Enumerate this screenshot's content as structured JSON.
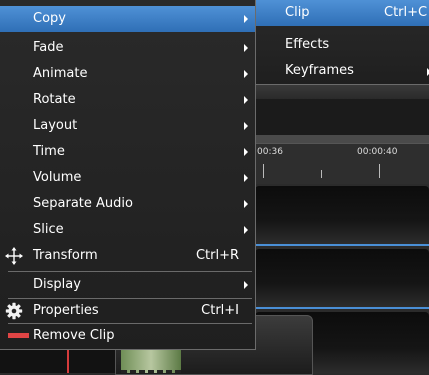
{
  "menu": {
    "items": [
      {
        "label": "Copy",
        "shortcut": "",
        "submenu": true
      },
      {
        "label": "Fade",
        "shortcut": "",
        "submenu": true
      },
      {
        "label": "Animate",
        "shortcut": "",
        "submenu": true
      },
      {
        "label": "Rotate",
        "shortcut": "",
        "submenu": true
      },
      {
        "label": "Layout",
        "shortcut": "",
        "submenu": true
      },
      {
        "label": "Time",
        "shortcut": "",
        "submenu": true
      },
      {
        "label": "Volume",
        "shortcut": "",
        "submenu": true
      },
      {
        "label": "Separate Audio",
        "shortcut": "",
        "submenu": true
      },
      {
        "label": "Slice",
        "shortcut": "",
        "submenu": true
      },
      {
        "label": "Transform",
        "shortcut": "Ctrl+R",
        "submenu": false
      },
      {
        "label": "Display",
        "shortcut": "",
        "submenu": true
      },
      {
        "label": "Properties",
        "shortcut": "Ctrl+I",
        "submenu": false
      },
      {
        "label": "Remove Clip",
        "shortcut": "",
        "submenu": false
      }
    ]
  },
  "submenu": {
    "items": [
      {
        "label": "Clip",
        "shortcut": "Ctrl+C"
      },
      {
        "label": "Effects",
        "shortcut": ""
      },
      {
        "label": "Keyframes",
        "shortcut": ""
      }
    ]
  },
  "timeline": {
    "ticks": [
      "00:36",
      "00:00:40"
    ]
  },
  "colors": {
    "highlight": "#3d82cc",
    "remove_icon": "#e04545",
    "playhead": "#d63c3c"
  }
}
